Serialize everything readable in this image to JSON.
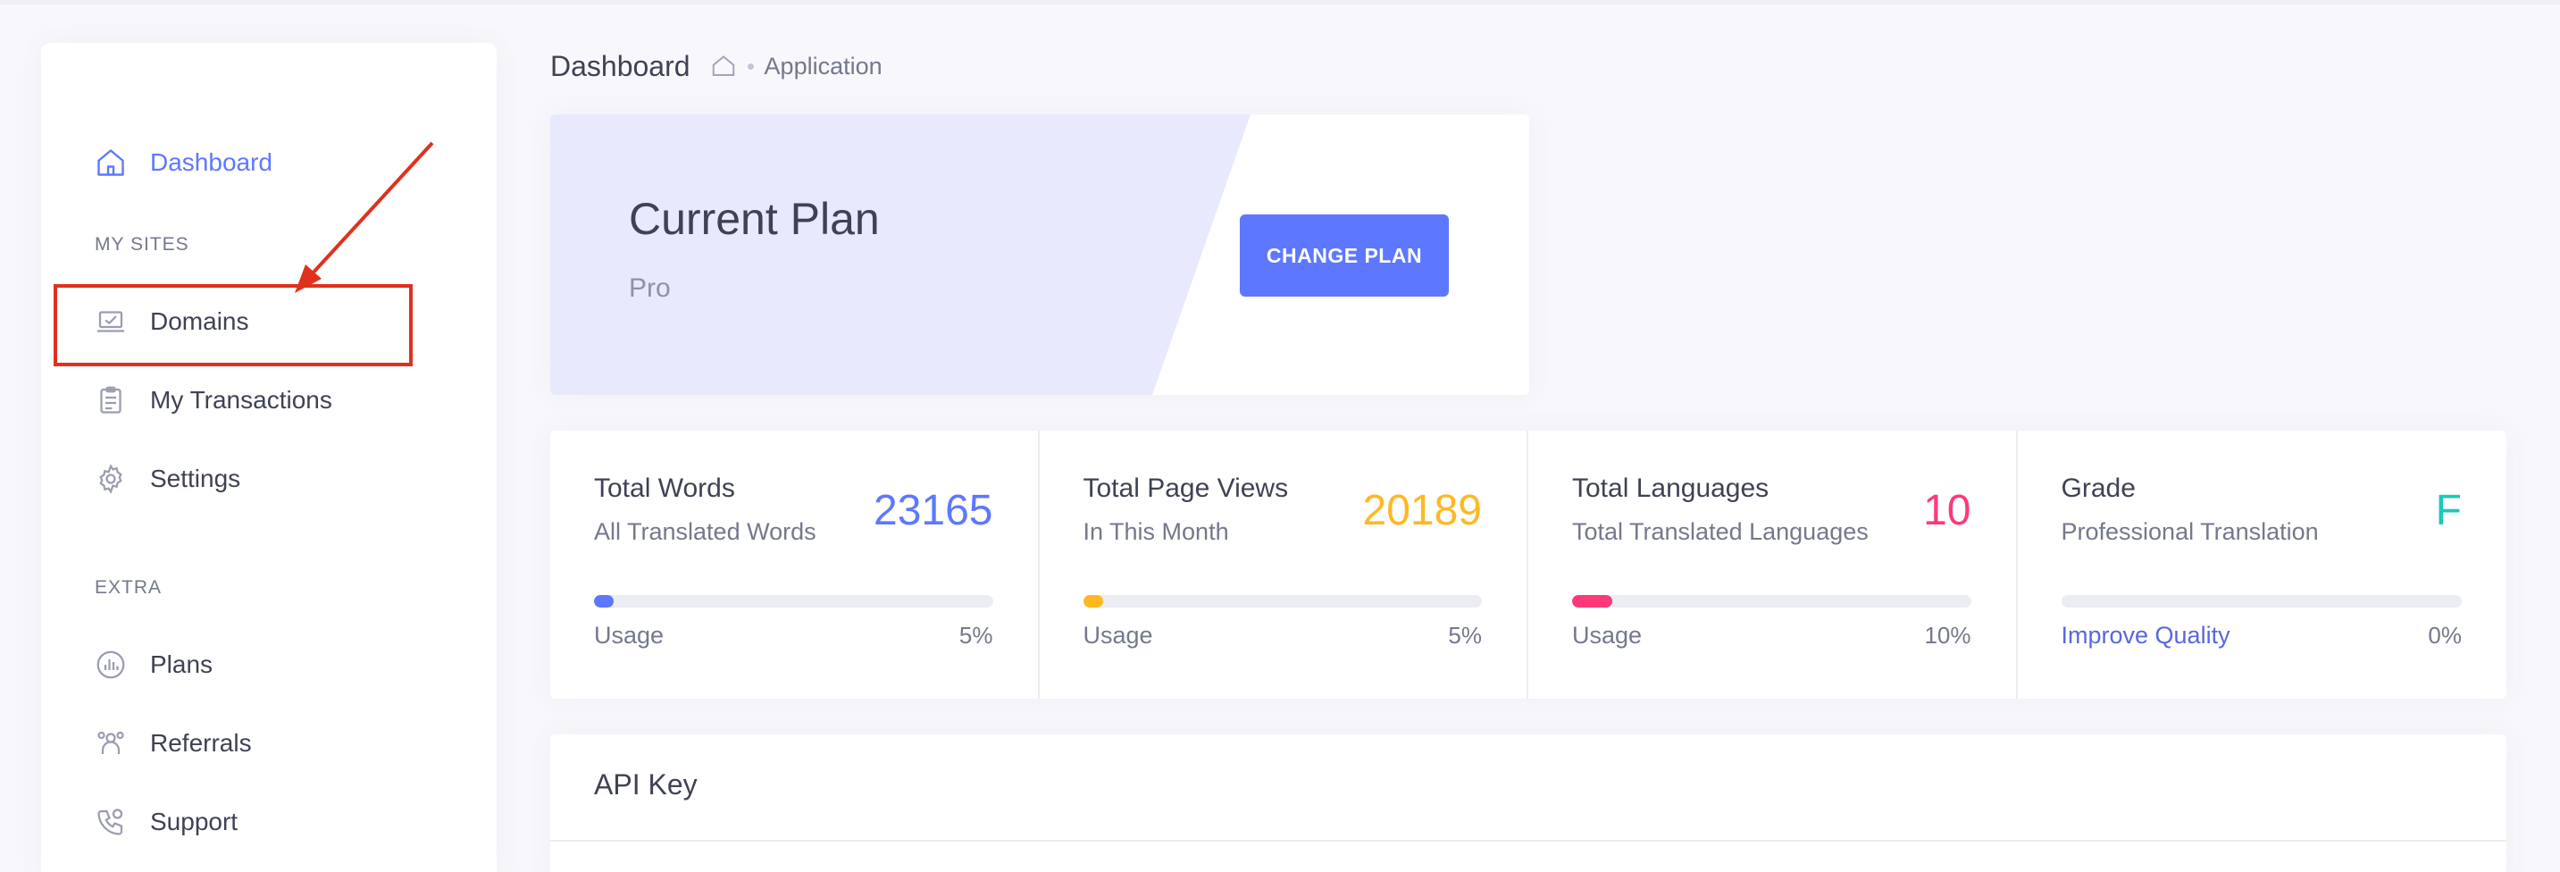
{
  "sidebar": {
    "dashboard_label": "Dashboard",
    "section_my_sites": "MY SITES",
    "domains_label": "Domains",
    "transactions_label": "My Transactions",
    "settings_label": "Settings",
    "section_extra": "EXTRA",
    "plans_label": "Plans",
    "referrals_label": "Referrals",
    "support_label": "Support"
  },
  "breadcrumb": {
    "title": "Dashboard",
    "crumb": "Application"
  },
  "plan": {
    "title": "Current Plan",
    "name": "Pro",
    "button_label": "CHANGE PLAN"
  },
  "stats": [
    {
      "title": "Total Words",
      "subtitle": "All Translated Words",
      "value": "23165",
      "value_color": "#5d78ff",
      "bar_color": "#5d78ff",
      "progress": 0.05,
      "label": "Usage",
      "percent": "5%"
    },
    {
      "title": "Total Page Views",
      "subtitle": "In This Month",
      "value": "20189",
      "value_color": "#ffb822",
      "bar_color": "#ffb822",
      "progress": 0.05,
      "label": "Usage",
      "percent": "5%"
    },
    {
      "title": "Total Languages",
      "subtitle": "Total Translated Languages",
      "value": "10",
      "value_color": "#fd397a",
      "bar_color": "#fd397a",
      "progress": 0.1,
      "label": "Usage",
      "percent": "10%"
    },
    {
      "title": "Grade",
      "subtitle": "Professional Translation",
      "value": "F",
      "value_color": "#1dc9b7",
      "bar_color": "#1dc9b7",
      "progress": 0.0,
      "label": "Improve Quality",
      "percent": "0%"
    }
  ],
  "api": {
    "title": "API Key"
  },
  "colors": {
    "accent": "#5d78ff",
    "annotation": "#e0301e"
  }
}
